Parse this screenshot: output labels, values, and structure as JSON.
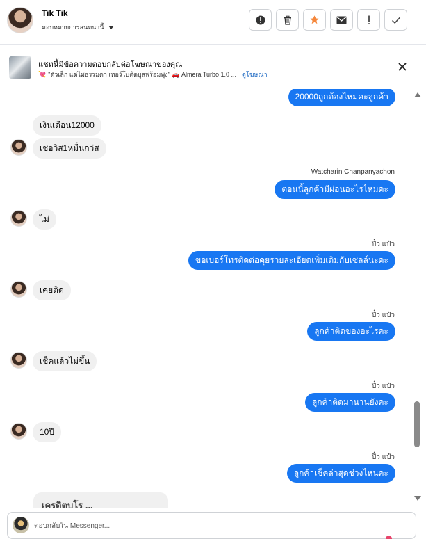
{
  "header": {
    "contact_name": "Tik Tik",
    "assign_label": "มอบหมายการสนทนานี้",
    "actions": [
      {
        "name": "report-icon",
        "label": "Report"
      },
      {
        "name": "trash-icon",
        "label": "Delete"
      },
      {
        "name": "star-icon",
        "label": "Star"
      },
      {
        "name": "mail-icon",
        "label": "Mark unread"
      },
      {
        "name": "exclamation-icon",
        "label": "Follow up"
      },
      {
        "name": "check-icon",
        "label": "Done"
      }
    ],
    "star_color": "#f5873b"
  },
  "ad_banner": {
    "title": "แชทนี้มีข้อความตอบกลับต่อโฆษณาของคุณ",
    "subtitle": "\"ตัวเล็ก แต่ไม่ธรรมดา เทอร์โบติดบูสพร้อมพุ่ง\" 🚗 Almera Turbo 1.0 ...",
    "link": "ดูโฆษณา"
  },
  "messages": [
    {
      "dir": "out",
      "text": "20000ถูกต้องไหมคะลูกค้า"
    },
    {
      "dir": "in",
      "text": "เงินเดือน12000"
    },
    {
      "dir": "in",
      "text": "เชอวิส1หมื่นกว่ส"
    },
    {
      "dir": "out",
      "sender": "Watcharin Chanpanyachon",
      "text": "ตอนนี้ลูกค้ามีผ่อนอะไรไหมคะ"
    },
    {
      "dir": "in",
      "text": "ไม่"
    },
    {
      "dir": "out",
      "sender": "ปิ๋ว แป๋ว",
      "text": "ขอเบอร์โทรติดต่อคุยรายละเอียดเพิ่มเติมกับเซลล์นะคะ"
    },
    {
      "dir": "in",
      "text": "เคยติด"
    },
    {
      "dir": "out",
      "sender": "ปิ๋ว แป๋ว",
      "text": "ลูกค้าติดของอะไรคะ"
    },
    {
      "dir": "in",
      "text": "เช็คแล้วไม่ขึ้น"
    },
    {
      "dir": "out",
      "sender": "ปิ๋ว แป๋ว",
      "text": "ลูกค้าติดมานานยังคะ"
    },
    {
      "dir": "in",
      "text": "10ปี"
    },
    {
      "dir": "out",
      "sender": "ปิ๋ว แป๋ว",
      "text": "ลูกค้าเช็คล่าสุดช่วงไหนคะ"
    }
  ],
  "partial_message": "เครดิตบูโร ...",
  "composer": {
    "placeholder": "ตอบกลับใน Messenger..."
  },
  "colors": {
    "outgoing_bubble": "#1877f2",
    "incoming_bubble": "#f0f0f0"
  }
}
